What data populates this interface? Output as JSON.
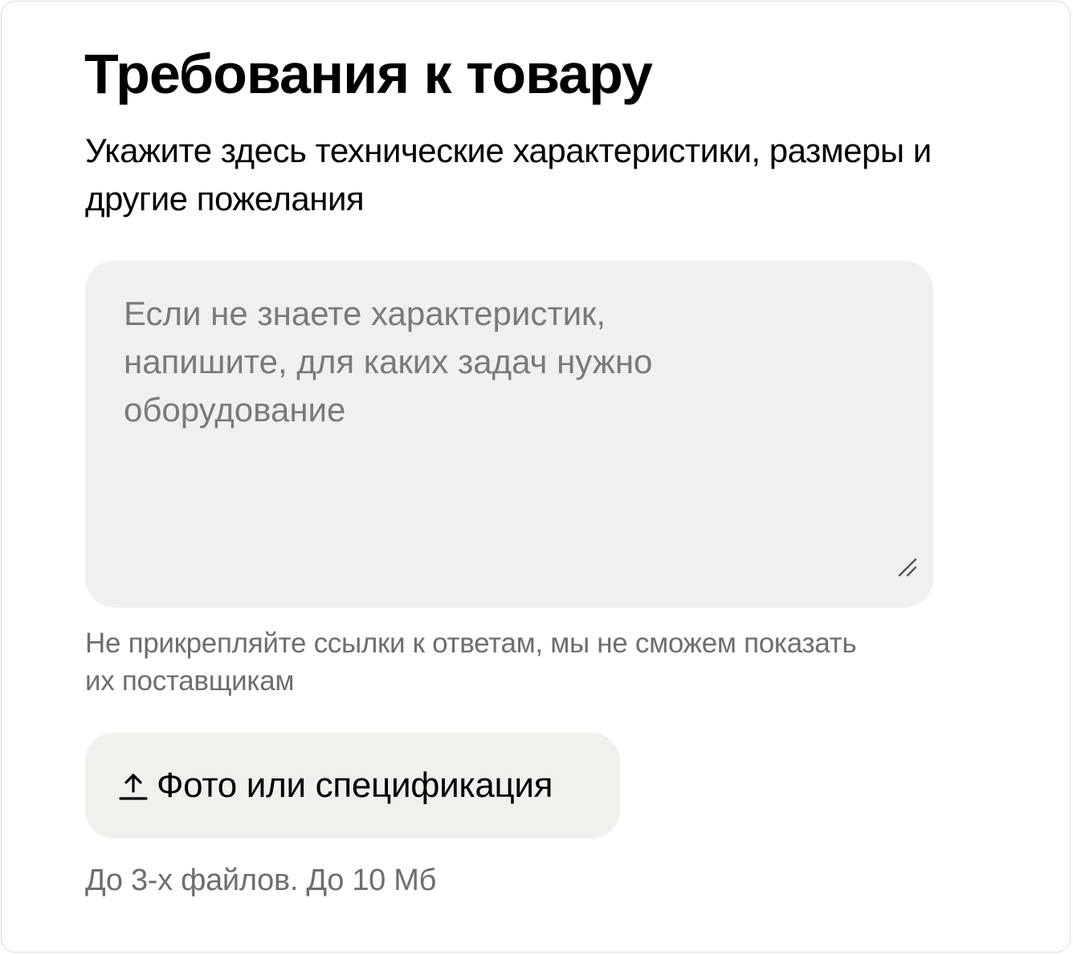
{
  "form": {
    "title": "Требования к товару",
    "subtitle": "Укажите здесь технические характеристики, размеры и другие пожелания",
    "requirements_field": {
      "value": "",
      "placeholder": "Если не знаете характеристик, напишите, для каких задач нужно оборудование"
    },
    "links_hint": "Не прикрепляйте ссылки к ответам, мы не сможем показать их поставщикам",
    "upload_button": {
      "label": "Фото или спецификация",
      "icon": "upload-icon"
    },
    "files_note": "До 3-х файлов. До 10 Мб"
  },
  "colors": {
    "field_background": "#f1f0ee",
    "button_background": "#f1f0ec",
    "hint_text": "#6e6e6e",
    "placeholder_text": "#7a7a7a"
  }
}
